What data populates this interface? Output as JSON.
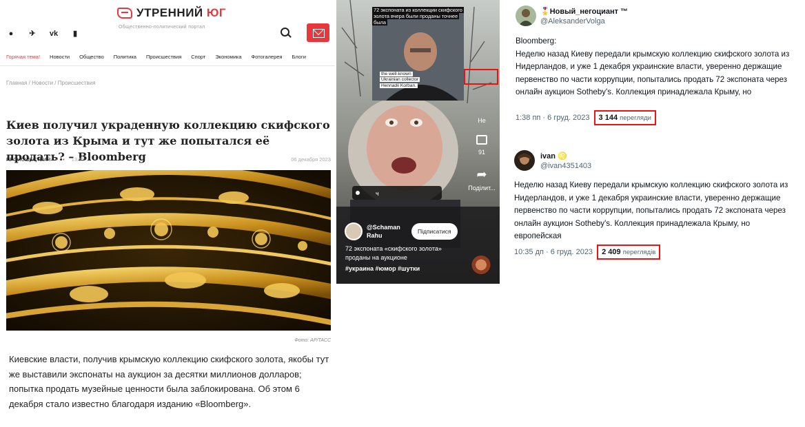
{
  "site": {
    "logo_part1": "УТРЕННИЙ",
    "logo_part2": "ЮГ",
    "tagline": "Общественно-политический портал",
    "socials": [
      "●",
      "✈",
      "vk",
      "▮"
    ],
    "nav": [
      "Горячая тема!",
      "Новости",
      "Общество",
      "Политика",
      "Происшествия",
      "Спорт",
      "Экономика",
      "Фотогалерея",
      "Блоги"
    ],
    "breadcrumbs": "Главная / Новости / Происшествия",
    "headline": "Киев получил украденную коллекцию скифского золота из Крыма и тут же попытался её продать? – Bloomberg",
    "category": "ПРОИСШЕСТВИЯ",
    "time": "13:52",
    "date": "06 декабря 2023",
    "photo_credit": "Фото: AP/TACC",
    "lead": "Киевские власти, получив крымскую коллекцию скифского золота, якобы тут же выставили экспонаты на аукцион за десятки миллионов долларов; попытка продать музейные ценности была заблокирована. Об этом 6 декабря стало известно благодаря изданию «Bloomberg»."
  },
  "video": {
    "inset_caption": "72 экспоната из коллекции скифского золота вчера были проданы точнее была",
    "inset_subtitle": "the well-known Ukrainian collector Hennadii Korban.",
    "side_label_1": "Не",
    "comments_count": "91",
    "share_label": "Подiлит...",
    "progress_label": "ч",
    "author": "@Schaman Rahu",
    "follow_label": "Підписатися",
    "description": "72 экспоната «скифского золота» проданы на аукционе",
    "tags": "#украина #юмор #шутки"
  },
  "tweets": [
    {
      "name": "🎖️Новый_негоциант ™",
      "handle": "@AleksanderVolga",
      "text_line0": "Bloomberg:",
      "text": "Неделю назад Киеву передали крымскую коллекцию скифского золота из Нидерландов, и уже 1 декабря украинские власти, уверенно держащие первенство по части коррупции, попытались продать 72 экспоната через онлайн аукцион Sotheby's. Коллекция принадлежала Крыму, но",
      "time": "1:38 пп · 6 груд. 2023",
      "views": "3 144",
      "views_label": "перегляди"
    },
    {
      "name": "ivan ♌",
      "handle": "@ivan4351403",
      "text": "Неделю назад Киеву передали крымскую коллекцию скифского золота из Нидерландов, и уже 1 декабря украинские власти, уверенно держащие первенство по части коррупции, попытались продать 72 экспоната через онлайн аукцион Sotheby's. Коллекция принадлежала Крыму, но европейская",
      "time": "10:35 дп · 6 груд. 2023",
      "views": "2 409",
      "views_label": "переглядів"
    }
  ],
  "colors": {
    "accent": "#e8383d",
    "highlight_box": "#ee1111"
  }
}
